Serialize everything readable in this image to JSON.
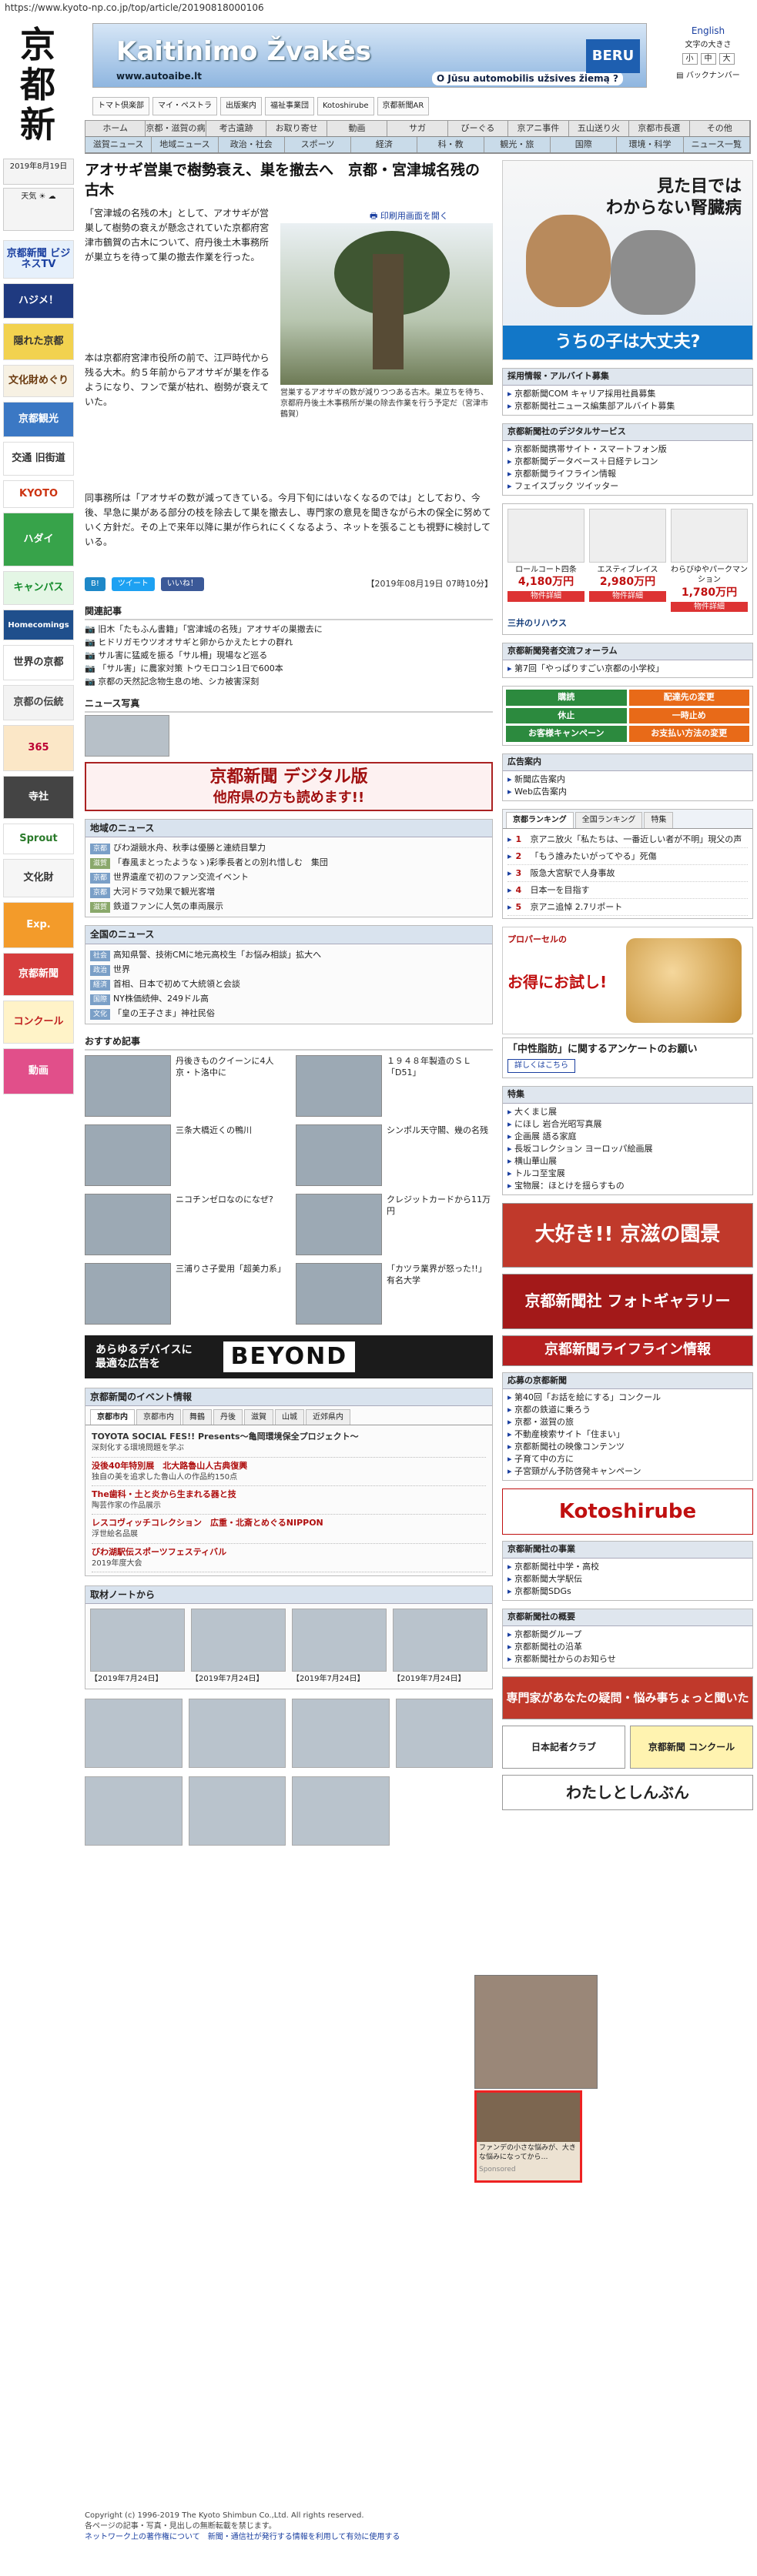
{
  "browser": {
    "url": "https://www.kyoto-np.co.jp/top/article/20190818000106"
  },
  "site": {
    "logo_chars": [
      "京",
      "都",
      "新",
      "聞"
    ],
    "date": "2019年8月19日",
    "weather_label": "天気"
  },
  "header_ad": {
    "title": "Kaitinimo Žvakės",
    "url": "www.autoaibe.lt",
    "slogan": "O Jūsu automobilis užsives žiemą ?",
    "brand": "BERU"
  },
  "header_right": {
    "english": "English",
    "size": "文字の大きさ",
    "size_options": [
      "小",
      "中",
      "大"
    ],
    "backnumber": "バックナンバー"
  },
  "top_links": [
    "トマト倶楽部",
    "マイ・ペストラ",
    "出版案内",
    "福祉事業団",
    "Kotoshirube",
    "京都新聞AR"
  ],
  "nav": {
    "row1": [
      "ホーム",
      "京都・滋賀の病院",
      "考古遺跡",
      "お取り寄せ",
      "動画",
      "サガ",
      "びーぐる",
      "京アニ事件",
      "五山送り火",
      "京都市長選",
      "その他"
    ],
    "row2": [
      "滋賀ニュース",
      "地域ニュース",
      "政治・社会",
      "スポーツ",
      "経済",
      "科・教",
      "観光・旅",
      "国際",
      "環境・科学",
      "ニュース一覧"
    ]
  },
  "article": {
    "title": "アオサギ営巣で樹勢衰え、巣を撤去へ　京都・宮津城名残の古木",
    "print": "印刷用画面を開く",
    "paragraphs": [
      "「宮津城の名残の木」として、アオサギが営巣して樹勢の衰えが懸念されていた京都府宮津市鶴賀の古木について、府丹後土木事務所が巣立ちを待って巣の撤去作業を行った。",
      "本は京都府宮津市役所の前で、江戸時代から残る大木。約５年前からアオサギが巣を作るようになり、フンで葉が枯れ、樹勢が衰えていた。",
      "同事務所は「アオサギの数が減ってきている。今月下旬にはいなくなるのでは」としており、今後、早急に巣がある部分の枝を除去して巣を撤去し、専門家の意見を聞きながら木の保全に努めていく方針だ。その上で来年以降に巣が作られにくくなるよう、ネットを張ることも視野に検討している。"
    ],
    "caption": "営巣するアオサギの数が減りつつある古木。巣立ちを待ち、京都府丹後土木事務所が巣の除去作業を行う予定だ（宮津市鶴賀）",
    "date": "【2019年08月19日 07時10分】",
    "share": [
      "B!",
      "ツイート",
      "いいね！"
    ]
  },
  "related": {
    "title": "関連記事",
    "items": [
      "旧木「たもふん書籍」「宮津城の名残」アオサギの巣撤去に",
      "ヒドリガモウツオオサギと卵からかえたヒナの群れ",
      "サル害に猛威を振る「サル柵」現場など巡る",
      "「サル害」に農家対策 トウモロコシ1日で600本",
      "京都の天然記念物生息の地、シカ被害深刻"
    ]
  },
  "news_photo": "ニュース写真",
  "digital_ad": {
    "line1": "京都新聞 デジタル版",
    "line2": "他府県の方も読めます!!"
  },
  "regional": {
    "title": "地域のニュース",
    "items": [
      [
        "京都",
        "びわ湖競水舟、秋季は優勝と連続目撃力"
      ],
      [
        "滋賀",
        "「春風まとったようなゝ)彩季長者との別れ惜しむ　集団"
      ],
      [
        "京都",
        "世界遺産で初のファン交流イベント"
      ],
      [
        "京都",
        "大河ドラマ効果で観光客増"
      ],
      [
        "滋賀",
        "鉄道ファンに人気の車両展示"
      ]
    ]
  },
  "national": {
    "title": "全国のニュース",
    "items": [
      [
        "社会",
        "高知県警、技術CMに地元高校生「お悩み相談」拡大へ"
      ],
      [
        "政治",
        "世界"
      ],
      [
        "経済",
        "首相、日本で初めて大統領と会談"
      ],
      [
        "国際",
        "NY株価続伸、249ドル高"
      ],
      [
        "文化",
        "「皇の王子さま」神社民俗"
      ]
    ]
  },
  "recommend": {
    "title": "おすすめ記事",
    "items": [
      "丹後きものクイーンに4人　京・ト洛中に",
      "１９４８年製造のＳＬ「D51」",
      "三条大橋近くの鴨川",
      "シンポル天守閣、幾の名残",
      "ニコチンゼロなのになぜ?",
      "クレジットカードから11万円",
      "三浦りさ子愛用「超美力系」",
      "「カツラ業界が怒った!!」有名大学"
    ]
  },
  "beyond_ad": {
    "line1": "あらゆるデバイスに",
    "line2": "最適な広告を",
    "brand": "BEYOND"
  },
  "events": {
    "title": "京都新聞のイベント情報",
    "tabs": [
      "京都市内",
      "京都市内",
      "舞鶴",
      "丹後",
      "滋賀",
      "山城",
      "近郊県内"
    ],
    "items": [
      {
        "h": "TOYOTA SOCIAL FES!! Presents～亀岡環境保全プロジェクト～",
        "d": "深刻化する環境問題を学ぶ"
      },
      {
        "h": "没後40年特別展　北大路魯山人古典復興",
        "d": "独自の美を追求した魯山人の作品約150点"
      },
      {
        "h": "The歯科・土と炎から生まれる器と技",
        "d": "陶芸作家の作品展示"
      },
      {
        "h": "レスコヴィッチコレクション　広重・北斎とめぐるNIPPON",
        "d": "浮世絵名品展"
      },
      {
        "h": "びわ湖駅伝スポーツフェスティバル",
        "d": "2019年度大会"
      }
    ]
  },
  "note": {
    "title": "取材ノートから",
    "items": [
      "【2019年7月24日】",
      "【2019年7月24日】",
      "【2019年7月24日】",
      "【2019年7月24日】"
    ]
  },
  "sidebar": {
    "cat_ad": {
      "title1": "見た目では",
      "title2": "わからない腎臓病",
      "button": "うちの子は大丈夫?"
    },
    "jobs": {
      "title": "採用情報・アルバイト募集",
      "items": [
        "京都新聞COM キャリア採用社員募集",
        "京都新聞社ニュース編集部アルバイト募集"
      ]
    },
    "digital": {
      "title": "京都新聞社のデジタルサービス",
      "items": [
        "京都新聞携帯サイト・スマートフォン版",
        "京都新聞データベース＋日経テレコン",
        "京都新聞ライフライン情報",
        "フェイスブック ツイッター"
      ]
    },
    "mansion": [
      {
        "name": "ロールコート四条",
        "price": "4,180万円",
        "btn": "物件詳細"
      },
      {
        "name": "エスティブレイス",
        "price": "2,980万円",
        "btn": "物件詳細"
      },
      {
        "name": "わらびゆやパークマンション",
        "price": "1,780万円",
        "btn": "物件詳細"
      }
    ],
    "mitsui": "三井のリハウス",
    "forum": {
      "title": "京都新聞発者交流フォーラム",
      "items": [
        "第7回「やっぱりすごい京都の小学校」"
      ]
    },
    "services": [
      "購読",
      "配達先の変更",
      "休止",
      "一時止め",
      "お客様キャンペーン",
      "お支払い方法の変更"
    ],
    "adguide": {
      "title": "広告案内",
      "items": [
        "新聞広告案内",
        "Web広告案内"
      ]
    },
    "ranking": {
      "title": "京都ランキング",
      "tabs": [
        "全国ランキング",
        "特集"
      ],
      "items": [
        "京アニ放火「私たちは、一番近しい者が不明」現父の声",
        "「もう誰みたいがってやる」死傷",
        "阪急大宮駅で人身事故",
        "日本一を目指す",
        "京アニ追悼 2.7リポート"
      ]
    },
    "cosme": {
      "t1": "プロパーセルの",
      "t2": "お得にお試し!"
    },
    "survey": {
      "title": "「中性脂肪」に関するアンケートのお願い",
      "btn": "詳しくはこちら"
    },
    "special": {
      "title": "特集",
      "items": [
        "大くまじ展",
        "にほし 岩合光昭写真展",
        "企画展 語る家庭",
        "長坂コレクション ヨーロッパ絵画展",
        "横山華山展",
        "トルコ至宝展",
        "宝物展：ほとけを揺らすもの"
      ]
    },
    "contents": [
      "大好き!! 京滋の園景",
      "京都新聞社 フォトギャラリー",
      "京都新聞ライフライン情報"
    ],
    "campaigns": {
      "title": "応募の京都新聞",
      "items": [
        "第40回「お話を絵にする」コンクール",
        "京都の鉄道に乗ろう",
        "京都・滋賀の旅",
        "不動産検索サイト「住まい」",
        "京都新聞社の映像コンテンツ",
        "子育て中の方に",
        "子宮頸がん予防啓発キャンペーン"
      ]
    },
    "kotoshirube": "Kotoshirube",
    "business": {
      "title": "京都新聞社の事業",
      "items": [
        "京都新聞社中学・高校",
        "京都新聞大学駅伝",
        "京都新聞SDGs"
      ]
    },
    "company": {
      "title": "京都新聞社の概要",
      "items": [
        "京都新聞グループ",
        "京都新聞社の沿革",
        "京都新聞社からのお知らせ"
      ]
    },
    "bottom_ads": [
      "専門家があなたの疑問・悩み事ちょっと聞いた",
      "日本記者クラブ",
      "京都新聞 コンクール",
      "わたしとしんぶん"
    ]
  },
  "sponsor": {
    "text": "ファンデの小さな悩みが、大きな悩みになってから…",
    "label": "Sponsored"
  },
  "footer": {
    "copyright": "Copyright (c) 1996-2019 The Kyoto Shimbun Co.,Ltd. All rights reserved.",
    "line2": "各ページの記事・写真・見出しの無断転載を禁じます。",
    "line3": "ネットワーク上の著作権について　新聞・通信社が発行する情報を利用して有効に使用する"
  },
  "left": {
    "banners": [
      "京都新聞 ビジネスTV",
      "ハジメ！",
      "隠れた京都",
      "文化財めぐり",
      "京都観光",
      "交通 旧街道",
      "KYOTO",
      "ハダイ",
      "キャンパス",
      "Homecomings",
      "世界の京都",
      "京都の伝統",
      "365",
      "寺社",
      "Sprout",
      "文化財",
      "Exp.",
      "京都新聞",
      "コンクール",
      "動画"
    ]
  }
}
